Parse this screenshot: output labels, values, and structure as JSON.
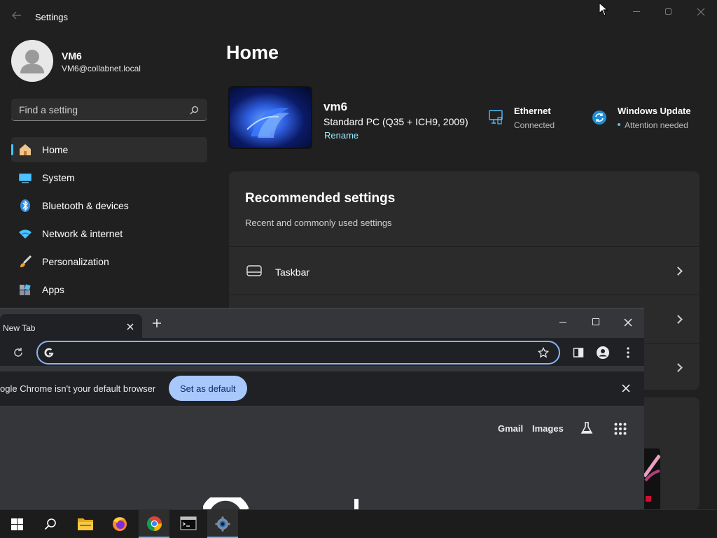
{
  "settings": {
    "window_title": "Settings",
    "user": {
      "name": "VM6",
      "email": "VM6@collabnet.local"
    },
    "search": {
      "placeholder": "Find a setting"
    },
    "nav": [
      {
        "label": "Home",
        "icon": "home-icon",
        "active": true
      },
      {
        "label": "System",
        "icon": "system-icon"
      },
      {
        "label": "Bluetooth & devices",
        "icon": "bluetooth-icon"
      },
      {
        "label": "Network & internet",
        "icon": "wifi-icon"
      },
      {
        "label": "Personalization",
        "icon": "brush-icon"
      },
      {
        "label": "Apps",
        "icon": "apps-icon"
      }
    ],
    "page_title": "Home",
    "device": {
      "name": "vm6",
      "model": "Standard PC (Q35 + ICH9, 2009)",
      "rename": "Rename"
    },
    "status": [
      {
        "title": "Ethernet",
        "subtitle": "Connected",
        "icon": "ethernet-icon"
      },
      {
        "title": "Windows Update",
        "subtitle": "Attention needed",
        "icon": "update-icon"
      }
    ],
    "recommended": {
      "title": "Recommended settings",
      "subtitle": "Recent and commonly used settings",
      "rows": [
        {
          "label": "Taskbar",
          "icon": "taskbar-icon"
        }
      ]
    }
  },
  "chrome": {
    "tab": {
      "title": "New Tab"
    },
    "infobar": {
      "message": "ogle Chrome isn't your default browser",
      "button": "Set as default"
    },
    "links": {
      "gmail": "Gmail",
      "images": "Images"
    }
  },
  "taskbar": {
    "apps": [
      "start-icon",
      "search-icon",
      "file-explorer-icon",
      "firefox-icon",
      "chrome-icon",
      "terminal-icon",
      "settings-icon"
    ]
  },
  "colors": {
    "accent": "#4cc2ff",
    "chrome_accent": "#8ab4f8",
    "background": "#202020"
  }
}
